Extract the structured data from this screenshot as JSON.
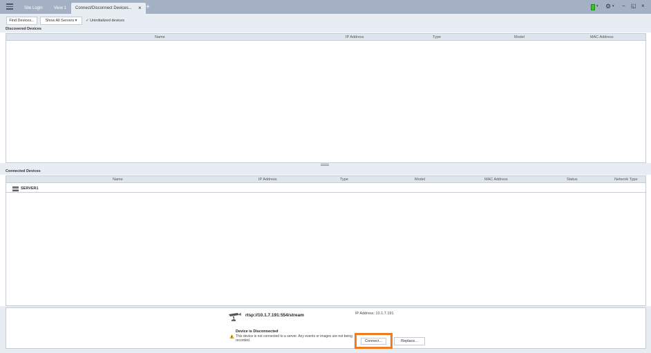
{
  "tabs": [
    {
      "label": "Site Login"
    },
    {
      "label": "View 1"
    },
    {
      "label": "Connect/Disconnect Devices..."
    }
  ],
  "titlebar": {
    "close_tab": "×",
    "add_tab": "+",
    "minimize": "−",
    "restore": "◱",
    "close": "×",
    "caret": "▾",
    "gear": "⚙"
  },
  "toolbar": {
    "find_devices": "Find Devices...",
    "show_all_servers": "Show All Servers ▾",
    "check_mark": "✓",
    "uninitialized": "Uninitialized devices"
  },
  "discovered": {
    "title": "Discovered Devices",
    "columns": [
      "Name",
      "IP Address",
      "Type",
      "Model",
      "MAC Address"
    ]
  },
  "connected": {
    "title": "Connected Devices",
    "columns": [
      "Name",
      "IP Address",
      "Type",
      "Model",
      "MAC Address",
      "Status",
      "Network Type"
    ],
    "rows": [
      {
        "name": "SERVER1"
      }
    ]
  },
  "detail": {
    "stream_url": "rtsp://10.1.7.191:554/stream",
    "ip_address_label": "IP Address: 10.1.7.191",
    "status_title": "Device is Disconnected",
    "status_message": "This device is not connected to a server. Any events or images are not being recorded.",
    "connect_label": "Connect...",
    "replace_label": "Replace..."
  },
  "colors": {
    "titlebar": "#a4b1c4",
    "highlight": "#f07c22",
    "status_green": "#35c72a",
    "warning": "#f2b01e"
  },
  "icons": {
    "menu": "hamburger-icon",
    "server": "server-icon",
    "camera": "camera-icon",
    "warning": "warning-icon",
    "settings": "gear-icon"
  }
}
